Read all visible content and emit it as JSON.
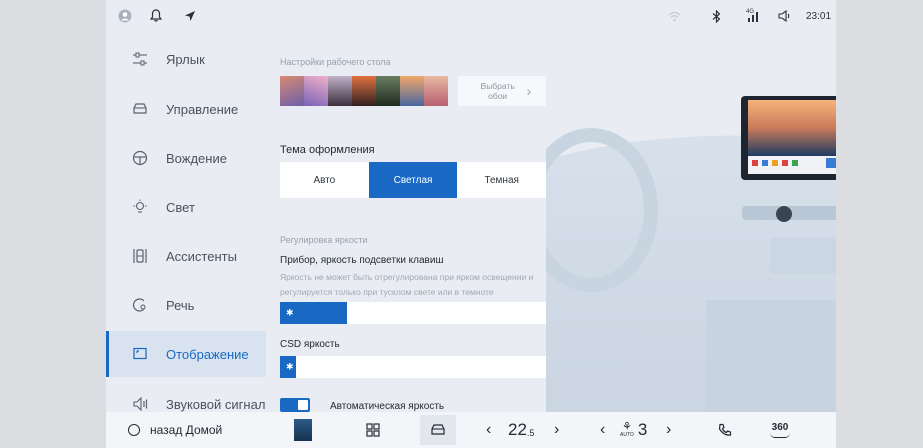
{
  "status_bar": {
    "time": "23:01",
    "signal_label": "4G",
    "icons": [
      "profile-icon",
      "bell-icon",
      "location-arrow-icon",
      "wifi-icon",
      "bluetooth-icon",
      "cellular-signal-icon",
      "volume-icon"
    ]
  },
  "sidebar": {
    "items": [
      {
        "label": "Ярлык",
        "icon": "shortcut-sliders-icon"
      },
      {
        "label": "Управление",
        "icon": "car-control-icon"
      },
      {
        "label": "Вождение",
        "icon": "steering-wheel-icon"
      },
      {
        "label": "Свет",
        "icon": "light-bulb-icon"
      },
      {
        "label": "Ассистенты",
        "icon": "assistant-icon"
      },
      {
        "label": "Речь",
        "icon": "voice-icon"
      },
      {
        "label": "Отображение",
        "icon": "display-icon",
        "active": true
      },
      {
        "label": "Звуковой сигнал",
        "icon": "speaker-icon"
      }
    ]
  },
  "content": {
    "desktop_settings_label": "Настройки рабочего стола",
    "choose_wallpaper_label": "Выбрать обои",
    "theme_heading": "Тема оформления",
    "theme_options": [
      "Авто",
      "Светлая",
      "Темная"
    ],
    "theme_selected": "Светлая",
    "brightness_section_label": "Регулировка яркости",
    "instrument_heading": "Прибор, яркость подсветки клавиш",
    "instrument_desc": "Яркость не может быть отрегулирована при ярком освещении и регулируется только при тусклом свете или в темноте",
    "instrument_brightness_fraction": 0.25,
    "csd_heading": "CSD яркость",
    "csd_brightness_fraction": 0.06,
    "auto_brightness_label": "Автоматическая яркость",
    "auto_brightness_on": true
  },
  "dock": {
    "home_label": "назад Домой",
    "temperature": "22",
    "temperature_decimal": ".5",
    "fan_label": "AUTO",
    "fan_speed": "3",
    "camera_label": "360",
    "icons": [
      "home-circle-icon",
      "driver-avatar-icon",
      "apps-grid-icon",
      "car-icon",
      "phone-icon",
      "camera-360-icon"
    ]
  },
  "colors": {
    "accent": "#1868c4",
    "screen_bg": "#e9edf3",
    "dock_bg": "#f3f5f8",
    "outer_bg": "#dcdde0"
  }
}
